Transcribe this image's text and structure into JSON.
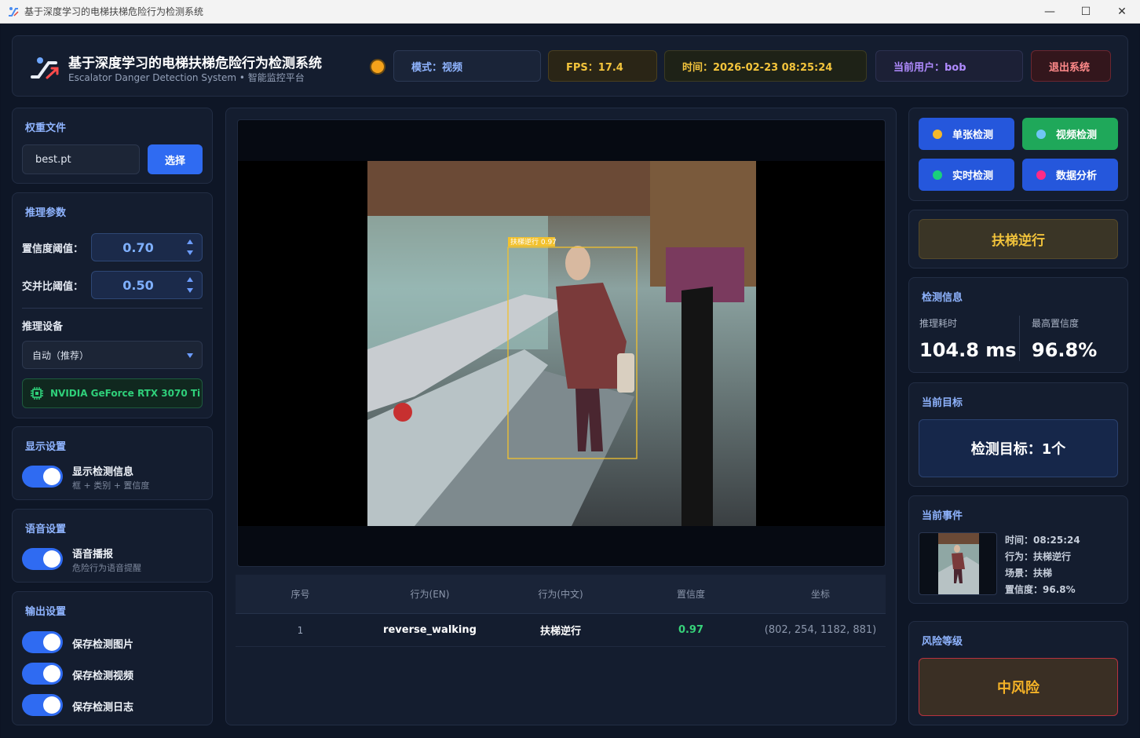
{
  "window": {
    "title": "基于深度学习的电梯扶梯危险行为检测系统"
  },
  "header": {
    "title": "基于深度学习的电梯扶梯危险行为检测系统",
    "subtitle": "Escalator Danger Detection System • 智能监控平台",
    "mode": "模式：视频",
    "fps": "FPS：17.4",
    "time": "时间：2026-02-23 08:25:24",
    "user": "当前用户：bob",
    "exit_label": "退出系统",
    "status_color": "#f5a21b"
  },
  "weights": {
    "title": "权重文件",
    "file": "best.pt",
    "choose_label": "选择"
  },
  "inference": {
    "title": "推理参数",
    "conf_label": "置信度阈值：",
    "conf_value": "0.70",
    "iou_label": "交并比阈值：",
    "iou_value": "0.50",
    "device_label": "推理设备",
    "device_value": "自动（推荐）",
    "gpu": "NVIDIA GeForce RTX 3070 Ti"
  },
  "display": {
    "title": "显示设置",
    "toggle_label": "显示检测信息",
    "toggle_sub": "框 + 类别 + 置信度",
    "enabled": true
  },
  "voice": {
    "title": "语音设置",
    "toggle_label": "语音播报",
    "toggle_sub": "危险行为语音提醒",
    "enabled": true
  },
  "output": {
    "title": "输出设置",
    "save_image": "保存检测图片",
    "save_video": "保存检测视频",
    "save_log": "保存检测日志"
  },
  "video": {
    "box_label": "扶梯逆行 0.97"
  },
  "table": {
    "headers": [
      "序号",
      "行为(EN)",
      "行为(中文)",
      "置信度",
      "坐标"
    ],
    "rows": [
      {
        "index": "1",
        "en": "reverse_walking",
        "zh": "扶梯逆行",
        "conf": "0.97",
        "coords": "(802, 254, 1182, 881)"
      }
    ]
  },
  "nav": {
    "single": "单张检测",
    "video": "视频检测",
    "realtime": "实时检测",
    "analysis": "数据分析",
    "dot_colors": {
      "single": "#f5b82a",
      "video": "#6fc6f5",
      "realtime": "#19d07c",
      "analysis": "#ff2a86"
    }
  },
  "behavior": {
    "label": "扶梯逆行"
  },
  "detection": {
    "title": "检测信息",
    "time_label": "推理耗时",
    "time_value": "104.8 ms",
    "max_conf_label": "最高置信度",
    "max_conf_value": "96.8%"
  },
  "target": {
    "title": "当前目标",
    "value": "检测目标：1个"
  },
  "event": {
    "title": "当前事件",
    "time": "时间：08:25:24",
    "behavior": "行为：扶梯逆行",
    "scene": "场景：扶梯",
    "confidence": "置信度：96.8%"
  },
  "risk": {
    "title": "风险等级",
    "value": "中风险",
    "color": "#f4b227"
  }
}
